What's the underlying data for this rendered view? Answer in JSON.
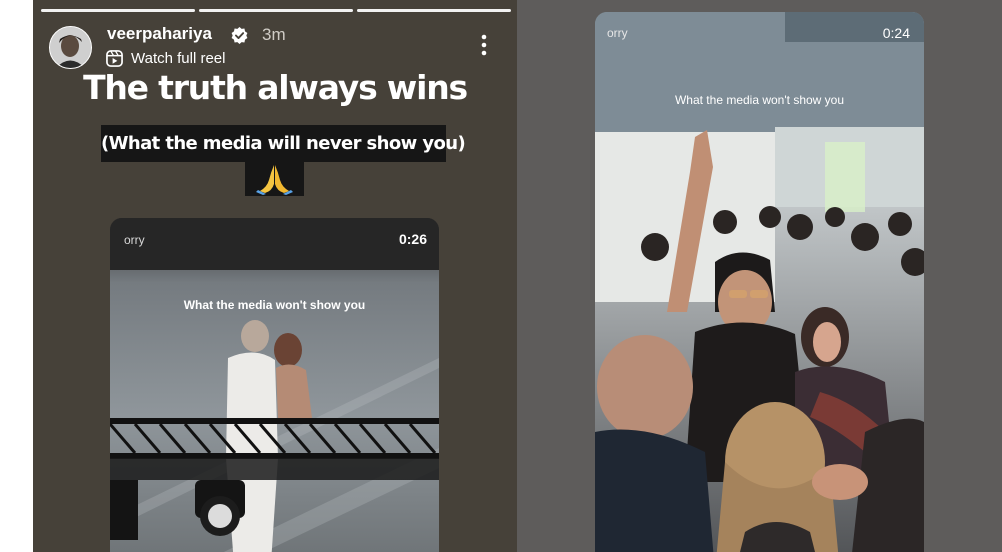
{
  "story": {
    "username": "veerpahariya",
    "post_time": "3m",
    "watch_reel_label": "Watch full reel",
    "headline": "The truth always wins",
    "subheadline": "(What the media will never show you)",
    "emoji": "🙏",
    "progress": [
      1.0,
      1.0,
      1.0
    ],
    "embed": {
      "author": "orry",
      "timestamp": "0:26",
      "caption": "What the media won't show you"
    }
  },
  "reel": {
    "author": "orry",
    "timestamp": "0:24",
    "caption": "What the media won't show you"
  },
  "colors": {
    "story_background": "#464139",
    "page_background": "#5e5c5b",
    "text_primary": "#ffffff"
  },
  "icons": {
    "verified": "verified-badge-icon",
    "reel": "reel-icon",
    "more": "more-vertical-icon"
  }
}
